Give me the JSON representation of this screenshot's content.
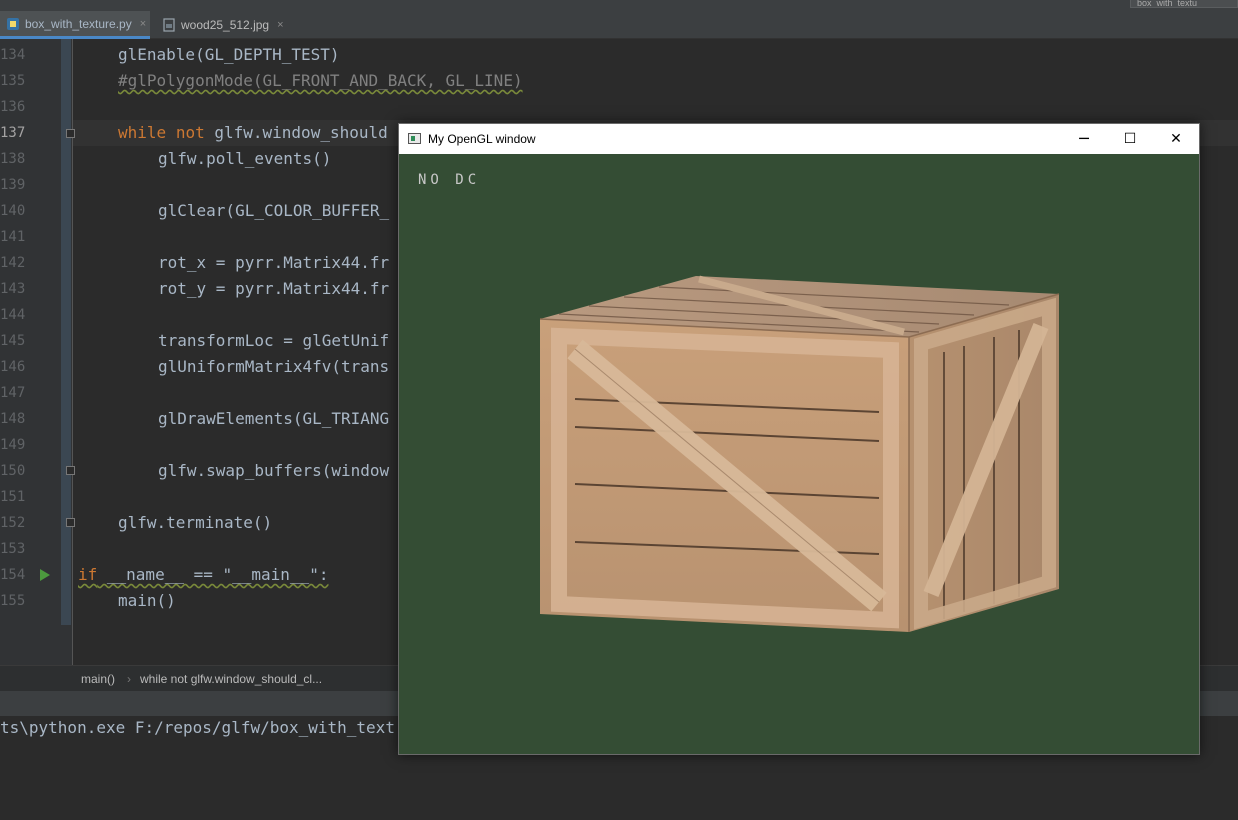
{
  "ide": {
    "top_right_label": "box_with_textu",
    "tabs": [
      {
        "label": "box_with_texture.py",
        "icon": "python-file-icon",
        "active": true
      },
      {
        "label": "wood25_512.jpg",
        "icon": "image-file-icon",
        "active": false
      }
    ],
    "close_glyph": "×",
    "line_numbers": [
      "134",
      "135",
      "136",
      "137",
      "138",
      "139",
      "140",
      "141",
      "142",
      "143",
      "144",
      "145",
      "146",
      "147",
      "148",
      "149",
      "150",
      "151",
      "152",
      "153",
      "154",
      "155"
    ],
    "current_line": "137",
    "code": {
      "l134": "glEnable(GL_DEPTH_TEST)",
      "l135": "#glPolygonMode(GL_FRONT_AND_BACK, GL_LINE)",
      "l137_kw1": "while",
      "l137_kw2": "not",
      "l137_rest": "glfw.window_should",
      "l138": "glfw.poll_events()",
      "l140": "glClear(GL_COLOR_BUFFER_",
      "l142": "rot_x = pyrr.Matrix44.fr",
      "l143": "rot_y = pyrr.Matrix44.fr",
      "l145": "transformLoc = glGetUnif",
      "l146": "glUniformMatrix4fv(trans",
      "l148": "glDrawElements(GL_TRIANG",
      "l150": "glfw.swap_buffers(window",
      "l152": "glfw.terminate()",
      "l154_kw": "if",
      "l154_rest": " __name__ == \"__main__\":",
      "l155": "main()"
    },
    "breadcrumb": [
      "main()",
      "while not glfw.window_should_cl..."
    ],
    "breadcrumb_sep": "›",
    "run_command": "ts\\python.exe F:/repos/glfw/box_with_text"
  },
  "gl_window": {
    "title": "My OpenGL window",
    "minimize_glyph": "─",
    "maximize_glyph": "☐",
    "close_glyph": "✕",
    "overlay_text": "NO DC",
    "background_color": "#344d34"
  },
  "colors": {
    "keyword": "#cc7832",
    "text": "#a9b7c6",
    "comment": "#808080",
    "run_icon": "#4c9a3e",
    "tab_underline": "#4a88c7"
  }
}
